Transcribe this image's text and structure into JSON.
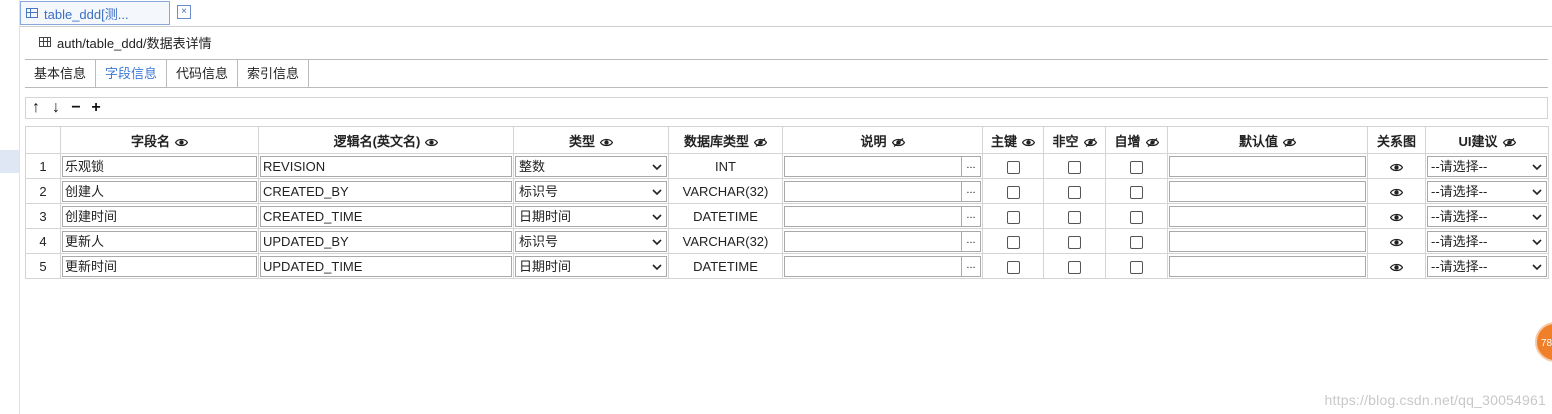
{
  "doc_tab": {
    "label": "table_ddd[测...",
    "close_symbol": "×"
  },
  "breadcrumb": "auth/table_ddd/数据表详情",
  "subtabs": [
    {
      "label": "基本信息",
      "active": false
    },
    {
      "label": "字段信息",
      "active": true
    },
    {
      "label": "代码信息",
      "active": false
    },
    {
      "label": "索引信息",
      "active": false
    }
  ],
  "toolbar": {
    "up": "↑",
    "down": "↓",
    "remove": "−",
    "add": "+"
  },
  "columns": {
    "num": "",
    "field_name": "字段名",
    "logic_name": "逻辑名(英文名)",
    "type": "类型",
    "db_type": "数据库类型",
    "desc": "说明",
    "pk": "主键",
    "not_null": "非空",
    "auto_inc": "自增",
    "default": "默认值",
    "relation": "关系图",
    "ui": "UI建议"
  },
  "rows": [
    {
      "num": "1",
      "field_name": "乐观锁",
      "logic_name": "REVISION",
      "type": "整数",
      "db_type": "INT",
      "desc": "",
      "default": "",
      "ui": "--请选择--"
    },
    {
      "num": "2",
      "field_name": "创建人",
      "logic_name": "CREATED_BY",
      "type": "标识号",
      "db_type": "VARCHAR(32)",
      "desc": "",
      "default": "",
      "ui": "--请选择--"
    },
    {
      "num": "3",
      "field_name": "创建时间",
      "logic_name": "CREATED_TIME",
      "type": "日期时间",
      "db_type": "DATETIME",
      "desc": "",
      "default": "",
      "ui": "--请选择--"
    },
    {
      "num": "4",
      "field_name": "更新人",
      "logic_name": "UPDATED_BY",
      "type": "标识号",
      "db_type": "VARCHAR(32)",
      "desc": "",
      "default": "",
      "ui": "--请选择--"
    },
    {
      "num": "5",
      "field_name": "更新时间",
      "logic_name": "UPDATED_TIME",
      "type": "日期时间",
      "db_type": "DATETIME",
      "desc": "",
      "default": "",
      "ui": "--请选择--"
    }
  ],
  "desc_button": "...",
  "watermark": "https://blog.csdn.net/qq_30054961",
  "badge": "78",
  "colors": {
    "accent": "#3c7ad6",
    "badge": "#f07f2a"
  }
}
